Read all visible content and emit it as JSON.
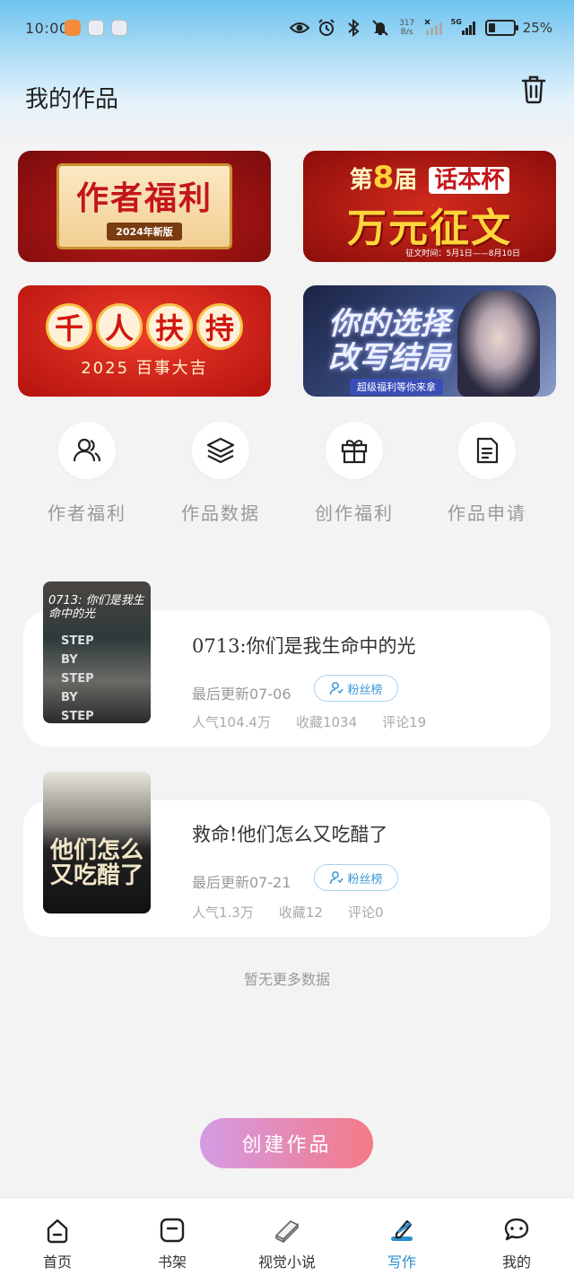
{
  "status_bar": {
    "time": "10:00",
    "net_speed_value": "317",
    "net_speed_unit": "B/s",
    "network": "5G",
    "battery": "25%"
  },
  "header": {
    "title": "我的作品"
  },
  "banners": [
    {
      "title": "作者福利",
      "subtitle": "2024年新版"
    },
    {
      "prefix": "第",
      "number": "8",
      "suffix": "届",
      "name": "话本杯",
      "main": "万元征文",
      "date": "征文时间：5月1日——8月10日"
    },
    {
      "chars": [
        "千",
        "人",
        "扶",
        "持"
      ],
      "subtitle": "2025 百事大吉"
    },
    {
      "title_line1": "你的选择",
      "title_line2": "改写结局",
      "subtitle": "超级福利等你来拿"
    }
  ],
  "quick_actions": [
    {
      "label": "作者福利",
      "icon": "users-icon"
    },
    {
      "label": "作品数据",
      "icon": "layers-icon"
    },
    {
      "label": "创作福利",
      "icon": "gift-icon"
    },
    {
      "label": "作品申请",
      "icon": "document-icon"
    }
  ],
  "works": [
    {
      "title": "0713:你们是我生命中的光",
      "updated": "最后更新07-06",
      "fans_label": "粉丝榜",
      "popularity": "人气104.4万",
      "favorites": "收藏1034",
      "comments": "评论19",
      "cover_text": "0713: 你们是我生命中的光",
      "cover_steps": [
        "STEP",
        "BY",
        "STEP",
        "BY",
        "STEP"
      ]
    },
    {
      "title": "救命!他们怎么又吃醋了",
      "updated": "最后更新07-21",
      "fans_label": "粉丝榜",
      "popularity": "人气1.3万",
      "favorites": "收藏12",
      "comments": "评论0",
      "cover_text": "他们怎么又吃醋了"
    }
  ],
  "no_more": "暂无更多数据",
  "create_button": "创建作品",
  "bottom_nav": [
    {
      "label": "首页",
      "icon": "home-icon"
    },
    {
      "label": "书架",
      "icon": "bookshelf-icon"
    },
    {
      "label": "视觉小说",
      "icon": "book-icon"
    },
    {
      "label": "写作",
      "icon": "pen-icon",
      "active": true
    },
    {
      "label": "我的",
      "icon": "chat-icon"
    }
  ],
  "colors": {
    "accent": "#2b8ed0",
    "create_start": "#d59be6",
    "create_end": "#f37a86"
  }
}
